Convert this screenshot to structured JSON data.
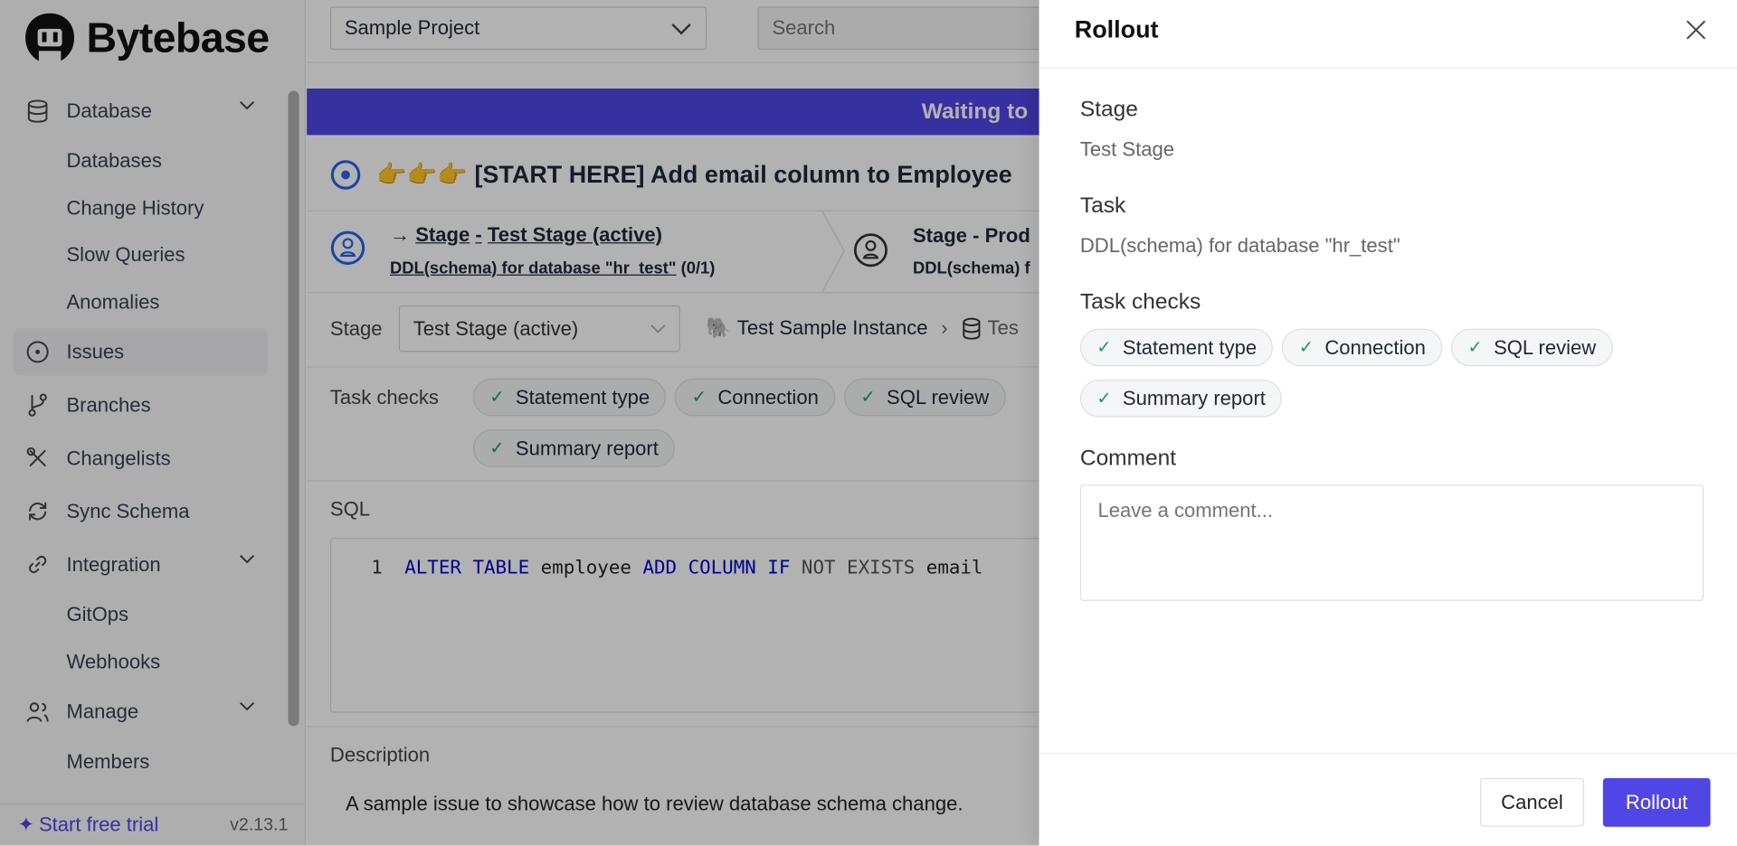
{
  "brand": {
    "name": "Bytebase"
  },
  "header": {
    "project": "Sample Project",
    "search_placeholder": "Search"
  },
  "sidebar": {
    "items": [
      {
        "label": "Database",
        "icon": "database-icon",
        "expandable": true
      },
      {
        "label": "Databases",
        "sub": true
      },
      {
        "label": "Change History",
        "sub": true
      },
      {
        "label": "Slow Queries",
        "sub": true
      },
      {
        "label": "Anomalies",
        "sub": true
      },
      {
        "label": "Issues",
        "icon": "issue-icon",
        "active": true
      },
      {
        "label": "Branches",
        "icon": "branch-icon"
      },
      {
        "label": "Changelists",
        "icon": "changelist-icon"
      },
      {
        "label": "Sync Schema",
        "icon": "sync-icon"
      },
      {
        "label": "Integration",
        "icon": "link-icon",
        "expandable": true
      },
      {
        "label": "GitOps",
        "sub": true
      },
      {
        "label": "Webhooks",
        "sub": true
      },
      {
        "label": "Manage",
        "icon": "users-icon",
        "expandable": true
      },
      {
        "label": "Members",
        "sub": true
      }
    ],
    "trial": "Start free trial",
    "version": "v2.13.1"
  },
  "issue": {
    "banner": "Waiting to",
    "title_emoji": "👉👉👉",
    "title": "[START HERE] Add email column to Employee",
    "stages": [
      {
        "arrow": "→",
        "prefix": "Stage",
        "sep": "-",
        "name": "Test Stage (active)",
        "task": "DDL(schema) for database \"hr_test\"",
        "count": "(0/1)"
      },
      {
        "title": "Stage - Prod",
        "task": "DDL(schema) f"
      }
    ],
    "stage_label": "Stage",
    "stage_select": "Test Stage (active)",
    "instance": "Test Sample Instance",
    "database": "Tes",
    "task_checks_label": "Task checks",
    "checks": [
      "Statement type",
      "Connection",
      "SQL review",
      "Summary report"
    ],
    "sql_label": "SQL",
    "sql": {
      "line": "1",
      "tokens": [
        {
          "t": "ALTER TABLE",
          "c": "#0000cc"
        },
        {
          "t": " employee ",
          "c": "#222"
        },
        {
          "t": "ADD COLUMN IF",
          "c": "#0000cc"
        },
        {
          "t": " NOT EXISTS",
          "c": "#555"
        },
        {
          "t": " email",
          "c": "#222"
        }
      ]
    },
    "description_label": "Description",
    "description": "A sample issue to showcase how to review database schema change."
  },
  "drawer": {
    "title": "Rollout",
    "stage_label": "Stage",
    "stage_value": "Test Stage",
    "task_label": "Task",
    "task_value": "DDL(schema) for database \"hr_test\"",
    "checks_label": "Task checks",
    "checks": [
      "Statement type",
      "Connection",
      "SQL review",
      "Summary report"
    ],
    "comment_label": "Comment",
    "comment_placeholder": "Leave a comment...",
    "cancel": "Cancel",
    "confirm": "Rollout"
  },
  "colors": {
    "accent": "#4f46e5",
    "success": "#18a058",
    "sql_keyword": "#0000cc"
  }
}
